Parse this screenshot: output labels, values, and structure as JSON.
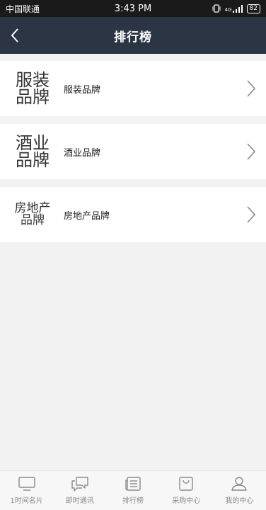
{
  "status": {
    "carrier": "中国联通",
    "time": "3:43 PM",
    "battery": "82",
    "network": "4G"
  },
  "nav": {
    "title": "排行榜"
  },
  "brands": [
    {
      "logo_line1": "服装",
      "logo_line2": "品牌",
      "label": "服装品牌"
    },
    {
      "logo_line1": "酒业",
      "logo_line2": "品牌",
      "label": "酒业品牌"
    },
    {
      "logo_line1": "房地产",
      "logo_line2": "品牌",
      "label": "房地产品牌"
    }
  ],
  "tabs": [
    {
      "label": "1时间名片",
      "icon": "tv-icon"
    },
    {
      "label": "即时通讯",
      "icon": "chat-icon"
    },
    {
      "label": "排行榜",
      "icon": "list-icon"
    },
    {
      "label": "采购中心",
      "icon": "shopping-bag-icon"
    },
    {
      "label": "我的中心",
      "icon": "user-icon"
    }
  ]
}
